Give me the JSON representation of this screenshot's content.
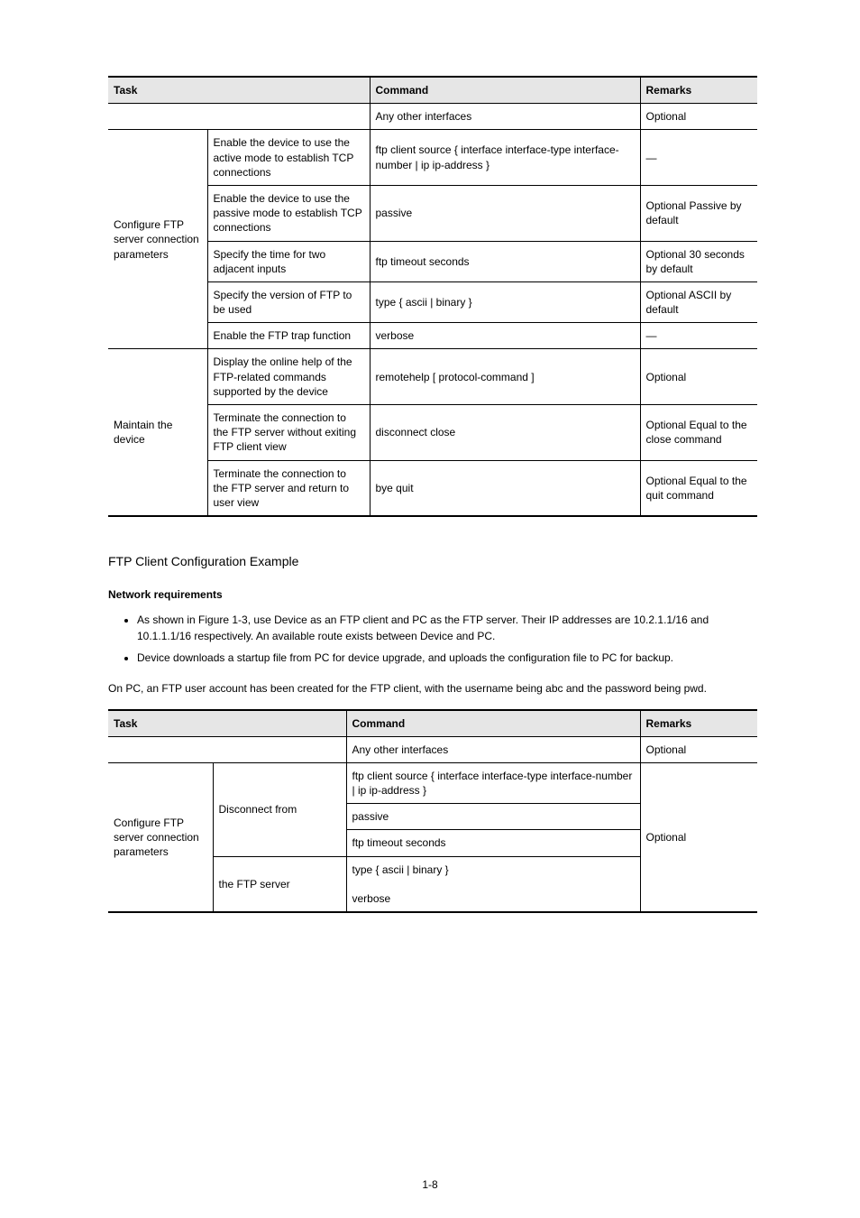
{
  "table1": {
    "headers": {
      "task": "Task",
      "command": "Command",
      "remarks": "Remarks"
    },
    "sub": {
      "c1": "",
      "c2": "",
      "c3": "Any other interfaces",
      "c4": "Optional"
    },
    "group1": {
      "label": "Configure FTP server connection parameters",
      "rows": [
        {
          "c2": "Enable the device to use the active mode to establish TCP connections",
          "c3": "ftp client source { interface interface-type interface-number | ip ip-address }",
          "c4": "—"
        },
        {
          "c2": "Enable the device to use the passive mode to establish TCP connections",
          "c3": "passive",
          "c4": "Optional\nPassive by default"
        },
        {
          "c2": "Specify the time for two adjacent inputs",
          "c3": "ftp timeout seconds",
          "c4": "Optional\n30 seconds by default"
        },
        {
          "c2": "Specify the version of FTP to be used",
          "c3": "type { ascii | binary }",
          "c4": "Optional\nASCII by default"
        },
        {
          "c2": "Enable the FTP trap function",
          "c3": "verbose",
          "c4": "—"
        }
      ]
    },
    "group2": {
      "label": "Maintain the device",
      "rows": [
        {
          "c2": "Display the online help of the FTP-related commands supported by the device",
          "c3": "remotehelp [ protocol-command ]",
          "c4": "Optional"
        },
        {
          "c2": "Terminate the connection to the FTP server without exiting FTP client view",
          "c3": "disconnect close",
          "c4": "Optional\nEqual to the close command"
        },
        {
          "c2": "Terminate the connection to the FTP server and return to user view",
          "c3": "bye quit",
          "c4": "Optional\nEqual to the quit command"
        }
      ]
    }
  },
  "section": {
    "title": "FTP Client Configuration Example",
    "netreq": "Network requirements",
    "bullets": [
      "As shown in Figure 1-3, use Device as an FTP client and PC as the FTP server. Their IP addresses are 10.2.1.1/16 and 10.1.1.1/16 respectively. An available route exists between Device and PC.",
      "Device downloads a startup file from PC for device upgrade, and uploads the configuration file to PC for backup."
    ],
    "bullet3": "On PC, an FTP user account has been created for the FTP client, with the username being abc and the password being pwd."
  },
  "table2": {
    "headers": {
      "task": "Task",
      "command": "Command",
      "remarks": "Remarks"
    },
    "sub": {
      "c1": "",
      "c2": "",
      "c3": "Any other interfaces",
      "c4": "Optional"
    },
    "group1": {
      "label": "Configure FTP server connection parameters",
      "sublabel": "Disconnect from",
      "rows": [
        {
          "c3": "ftp client source { interface interface-type interface-number | ip ip-address }",
          "c4": ""
        },
        {
          "c3": "passive",
          "c4": ""
        },
        {
          "c3": "ftp timeout seconds",
          "c4": "Optional"
        }
      ],
      "sub2": "the FTP server",
      "row4": {
        "c3": "type { ascii | binary }\n\nverbose",
        "c4": ""
      }
    }
  },
  "pageNum": "1-8"
}
